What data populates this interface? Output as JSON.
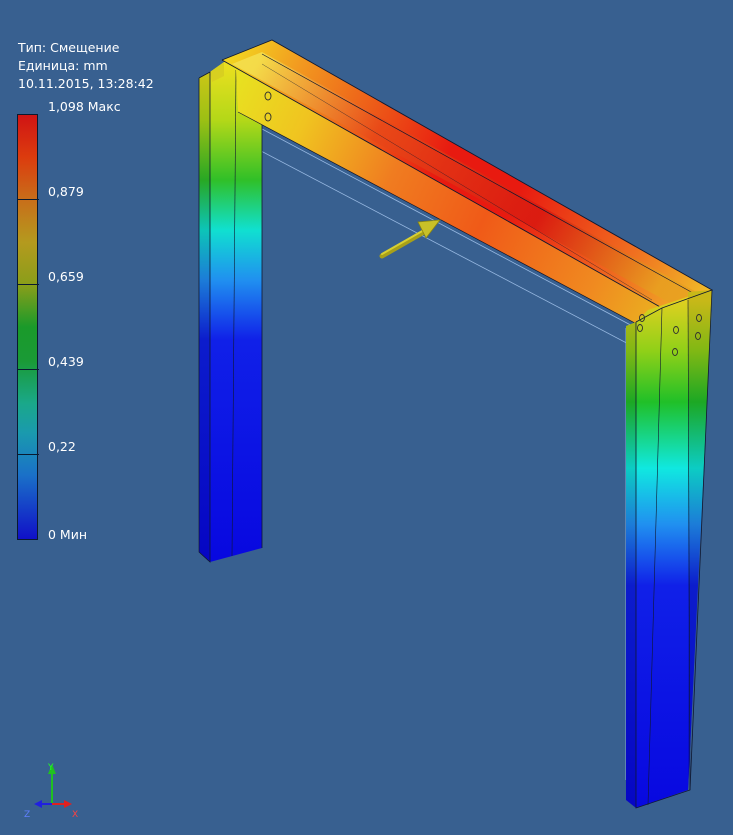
{
  "info": {
    "type_line": "Тип: Смещение",
    "unit_line": "Единица: mm",
    "timestamp": "10.11.2015, 13:28:42"
  },
  "legend": {
    "max_label": "1,098 Макс",
    "min_label": "0 Мин",
    "ticks": [
      "1,098 Макс",
      "0,879",
      "0,659",
      "0,439",
      "0,22",
      "0 Мин"
    ],
    "colors": [
      "#d01414",
      "#b49a1e",
      "#1a9a2a",
      "#1aa88a",
      "#1a70c8",
      "#1010c8"
    ]
  },
  "axes": {
    "x": "X",
    "y": "Y",
    "z": "Z"
  },
  "colors": {
    "background": "#386090",
    "load_arrow": "#c8c028"
  }
}
